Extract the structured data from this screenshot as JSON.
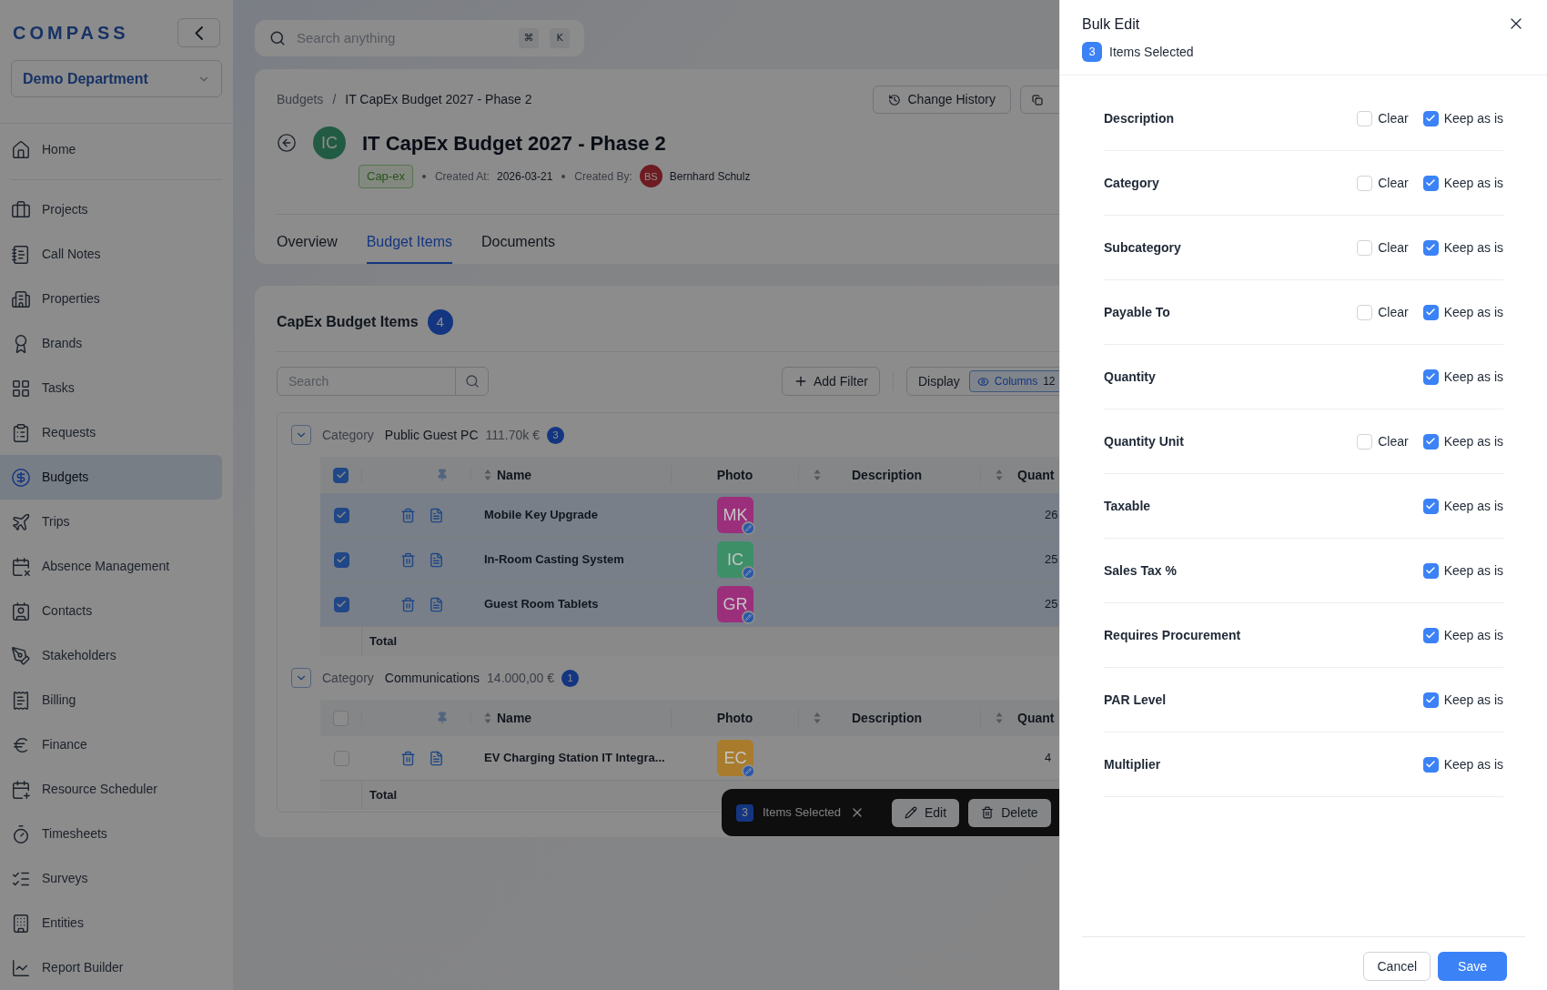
{
  "sidebar": {
    "logo": "COMPASS",
    "department": "Demo Department",
    "items": [
      {
        "label": "Home",
        "selected": false
      },
      {
        "label": "Projects",
        "selected": false
      },
      {
        "label": "Call Notes",
        "selected": false
      },
      {
        "label": "Properties",
        "selected": false
      },
      {
        "label": "Brands",
        "selected": false
      },
      {
        "label": "Tasks",
        "selected": false
      },
      {
        "label": "Requests",
        "selected": false
      },
      {
        "label": "Budgets",
        "selected": true
      },
      {
        "label": "Trips",
        "selected": false
      },
      {
        "label": "Absence Management",
        "selected": false
      },
      {
        "label": "Contacts",
        "selected": false
      },
      {
        "label": "Stakeholders",
        "selected": false
      },
      {
        "label": "Billing",
        "selected": false
      },
      {
        "label": "Finance",
        "selected": false
      },
      {
        "label": "Resource Scheduler",
        "selected": false
      },
      {
        "label": "Timesheets",
        "selected": false
      },
      {
        "label": "Surveys",
        "selected": false
      },
      {
        "label": "Entities",
        "selected": false
      },
      {
        "label": "Report Builder",
        "selected": false
      }
    ]
  },
  "search": {
    "placeholder": "Search anything",
    "keys": [
      "⌘",
      "K"
    ]
  },
  "header": {
    "breadcrumb": [
      "Budgets",
      "IT CapEx Budget 2027 - Phase 2"
    ],
    "breadcrumb_separator": "/",
    "change_history": "Change History",
    "avatar": "IC",
    "title": "IT CapEx Budget 2027 - Phase 2",
    "tag": "Cap-ex",
    "created_at_label": "Created At:",
    "created_at": "2026-03-21",
    "created_by_label": "Created By:",
    "creator_initials": "BS",
    "creator": "Bernhard Schulz"
  },
  "tabs": [
    {
      "label": "Overview",
      "selected": false
    },
    {
      "label": "Budget Items",
      "selected": true
    },
    {
      "label": "Documents",
      "selected": false
    }
  ],
  "items_panel": {
    "title": "CapEx Budget Items",
    "count": "4",
    "search_placeholder": "Search",
    "add_filter": "Add Filter",
    "display": "Display",
    "columns": "Columns",
    "columns_count": "12"
  },
  "groups": [
    {
      "label": "Category",
      "name": "Public Guest PC",
      "amount": "111.70k €",
      "count": "3",
      "expanded": true,
      "all_checked": true,
      "columns": [
        "Name",
        "Photo",
        "Description",
        "Quant"
      ],
      "total": "Total",
      "rows": [
        {
          "name": "Mobile Key Upgrade",
          "initials": "MK",
          "color": "#9c2f7c",
          "checked": true,
          "quantity": "26"
        },
        {
          "name": "In-Room Casting System",
          "initials": "IC",
          "color": "#3d8f68",
          "checked": true,
          "quantity": "25"
        },
        {
          "name": "Guest Room Tablets",
          "initials": "GR",
          "color": "#9c2f7c",
          "checked": true,
          "quantity": "25"
        }
      ]
    },
    {
      "label": "Category",
      "name": "Communications",
      "amount": "14.000,00 €",
      "count": "1",
      "expanded": true,
      "all_checked": false,
      "columns": [
        "Name",
        "Photo",
        "Description",
        "Quant"
      ],
      "total": "Total",
      "rows": [
        {
          "name": "EV Charging Station IT Integra...",
          "initials": "EC",
          "color": "#a87c2c",
          "checked": false,
          "quantity": "4"
        }
      ]
    }
  ],
  "selection_bar": {
    "count": "3",
    "label": "Items Selected",
    "edit": "Edit",
    "delete": "Delete"
  },
  "drawer": {
    "title": "Bulk Edit",
    "count": "3",
    "label": "Items Selected",
    "fields": [
      {
        "label": "Description",
        "options": [
          {
            "label": "Clear",
            "checked": false
          },
          {
            "label": "Keep as is",
            "checked": true
          }
        ]
      },
      {
        "label": "Category",
        "options": [
          {
            "label": "Clear",
            "checked": false
          },
          {
            "label": "Keep as is",
            "checked": true
          }
        ]
      },
      {
        "label": "Subcategory",
        "options": [
          {
            "label": "Clear",
            "checked": false
          },
          {
            "label": "Keep as is",
            "checked": true
          }
        ]
      },
      {
        "label": "Payable To",
        "options": [
          {
            "label": "Clear",
            "checked": false
          },
          {
            "label": "Keep as is",
            "checked": true
          }
        ]
      },
      {
        "label": "Quantity",
        "options": [
          {
            "label": "Keep as is",
            "checked": true
          }
        ]
      },
      {
        "label": "Quantity Unit",
        "options": [
          {
            "label": "Clear",
            "checked": false
          },
          {
            "label": "Keep as is",
            "checked": true
          }
        ]
      },
      {
        "label": "Taxable",
        "options": [
          {
            "label": "Keep as is",
            "checked": true
          }
        ]
      },
      {
        "label": "Sales Tax %",
        "options": [
          {
            "label": "Keep as is",
            "checked": true
          }
        ]
      },
      {
        "label": "Requires Procurement",
        "options": [
          {
            "label": "Keep as is",
            "checked": true
          }
        ]
      },
      {
        "label": "PAR Level",
        "options": [
          {
            "label": "Keep as is",
            "checked": true
          }
        ]
      },
      {
        "label": "Multiplier",
        "options": [
          {
            "label": "Keep as is",
            "checked": true
          }
        ]
      }
    ],
    "cancel": "Cancel",
    "save": "Save"
  }
}
